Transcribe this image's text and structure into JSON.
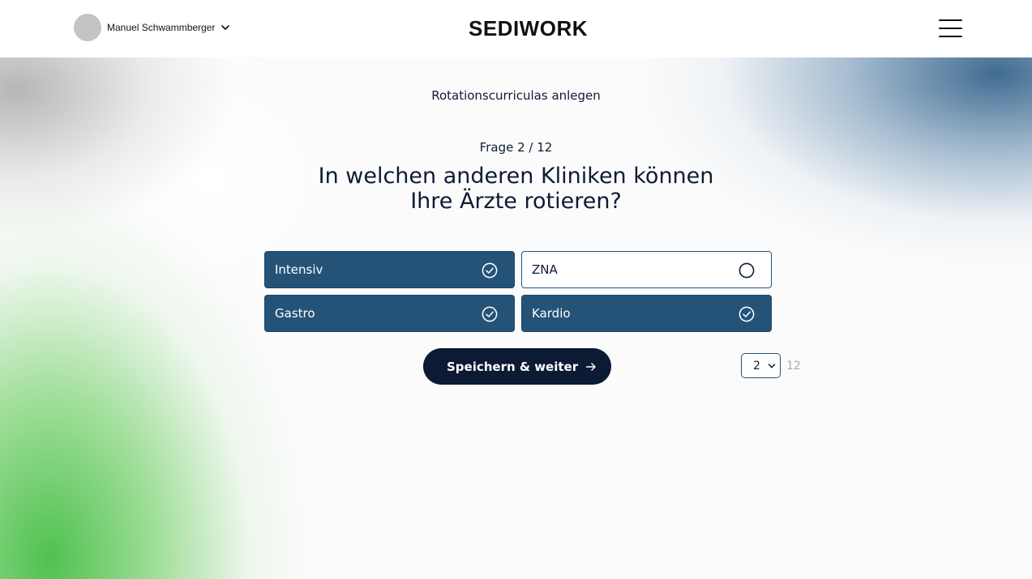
{
  "header": {
    "user_name": "Manuel Schwammberger",
    "logo_text": "SEDIWORK",
    "menu_icon": "hamburger-menu-icon"
  },
  "main": {
    "section_title": "Rotationscurriculas anlegen",
    "question_counter": "Frage 2 / 12",
    "question_line1": "In welchen anderen Kliniken können",
    "question_line2": "Ihre Ärzte rotieren?",
    "options": [
      {
        "label": "Intensiv",
        "selected": true
      },
      {
        "label": "ZNA",
        "selected": false
      },
      {
        "label": "Gastro",
        "selected": true
      },
      {
        "label": "Kardio",
        "selected": true
      }
    ],
    "save_button_label": "Speichern & weiter",
    "page_select_value": "2",
    "page_total": "12"
  },
  "colors": {
    "selected_option": "#255378",
    "button_dark": "#0d1a33",
    "text": "#0f1b33",
    "muted": "#a8a8a8"
  }
}
